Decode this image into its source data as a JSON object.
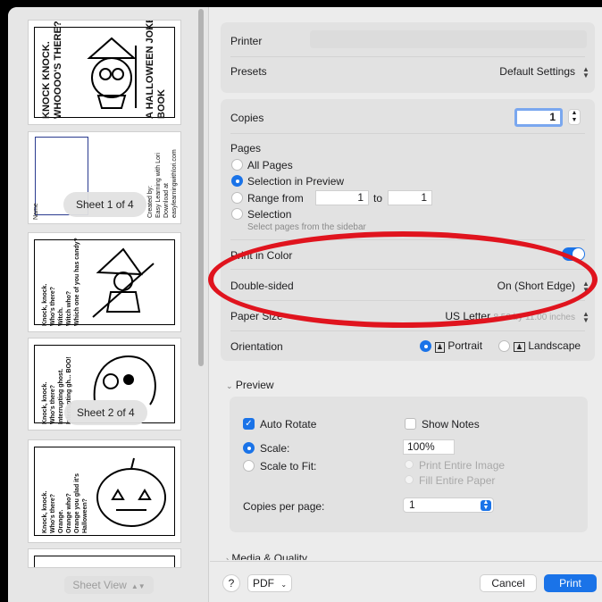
{
  "sidebar": {
    "pages": [
      {
        "title": "KNOCK KNOCK.\nWHOOOO'S THERE?",
        "subtitle": "A HALLOWEEN JOKE\nBOOK"
      },
      {
        "name_label": "Name",
        "credit": "Created by:\nEasy Learning with Lori\nDownload at\neasylearningwithlori.com"
      },
      {
        "joke": "Knock, knock.\nWho's there?\nWitch.\nWitch who?\nWhich one of you has candy?"
      },
      {
        "joke": "Knock, knock.\nWho's there?\nInterrupting ghost.\nInterrupting gh... BOO!"
      },
      {
        "joke": "Knock, knock.\nWho's there?\nOrange.\nOrange who?\nOrange you glad it's\nHalloween?"
      }
    ],
    "sheet_labels": [
      "Sheet 1 of 4",
      "Sheet 2 of 4"
    ],
    "sheet_view": "Sheet View"
  },
  "printer": {
    "label": "Printer",
    "value": ""
  },
  "presets": {
    "label": "Presets",
    "value": "Default Settings"
  },
  "copies": {
    "label": "Copies",
    "value": "1"
  },
  "pages": {
    "label": "Pages",
    "all": "All Pages",
    "selection_preview": "Selection in Preview",
    "range_from": "Range from",
    "range_from_value": "1",
    "to": "to",
    "range_to_value": "1",
    "selection": "Selection",
    "selection_hint": "Select pages from the sidebar"
  },
  "print_color": {
    "label": "Print in Color"
  },
  "double_sided": {
    "label": "Double-sided",
    "value": "On (Short Edge)"
  },
  "paper_size": {
    "label": "Paper Size",
    "value": "US Letter",
    "dims": "8.50 by 11.00 inches"
  },
  "orientation": {
    "label": "Orientation",
    "portrait": "Portrait",
    "landscape": "Landscape"
  },
  "preview": {
    "section": "Preview",
    "auto_rotate": "Auto Rotate",
    "show_notes": "Show Notes",
    "scale": "Scale:",
    "scale_value": "100%",
    "scale_to_fit": "Scale to Fit:",
    "print_entire_image": "Print Entire Image",
    "fill_entire_paper": "Fill Entire Paper",
    "copies_per_page": "Copies per page:",
    "copies_per_page_value": "1"
  },
  "media_quality": {
    "section": "Media & Quality"
  },
  "footer": {
    "help": "?",
    "pdf": "PDF",
    "cancel": "Cancel",
    "print": "Print"
  },
  "colors": {
    "accent": "#1a73e8",
    "annotation": "#e0141e"
  }
}
